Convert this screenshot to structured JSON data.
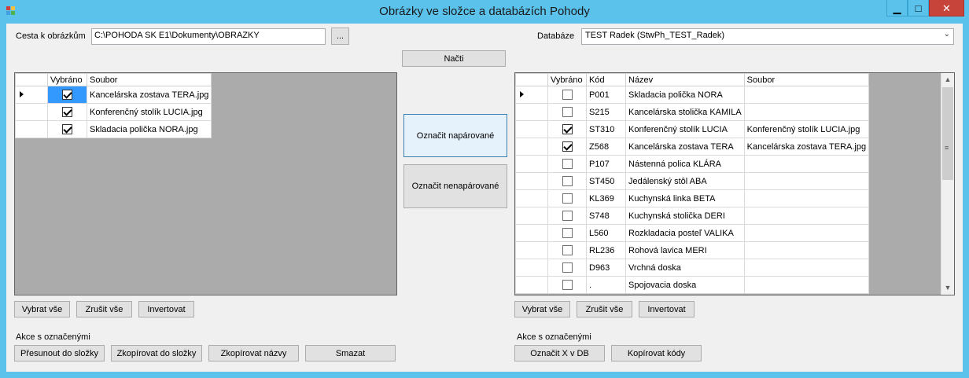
{
  "window": {
    "title": "Obrázky ve složce a databázích Pohody",
    "min_glyph": "▁",
    "max_glyph": "□",
    "close_glyph": "✕"
  },
  "top": {
    "path_label": "Cesta k obrázkům",
    "path_value": "C:\\POHODA SK E1\\Dokumenty\\OBRAZKY",
    "browse_label": "...",
    "db_label": "Databáze",
    "db_value": "TEST Radek  (StwPh_TEST_Radek)",
    "load_label": "Načti"
  },
  "left_grid": {
    "headers": [
      "Vybráno",
      "Soubor"
    ],
    "rows": [
      {
        "checked": true,
        "file": "Kancelárska zostava TERA.jpg"
      },
      {
        "checked": true,
        "file": "Konferenčný stolík LUCIA.jpg"
      },
      {
        "checked": true,
        "file": "Skladacia polička NORA.jpg"
      }
    ]
  },
  "middle": {
    "mark_paired": "Označit napárované",
    "mark_unpaired": "Označit nenapárované"
  },
  "right_grid": {
    "headers": [
      "Vybráno",
      "Kód",
      "Název",
      "Soubor"
    ],
    "rows": [
      {
        "checked": false,
        "code": "P001",
        "name": "Skladacia polička NORA",
        "file": ""
      },
      {
        "checked": false,
        "code": "S215",
        "name": "Kancelárska stolička KAMILA",
        "file": ""
      },
      {
        "checked": true,
        "code": "ST310",
        "name": "Konferenčný stolík LUCIA",
        "file": "Konferenčný stolík LUCIA.jpg"
      },
      {
        "checked": true,
        "code": "Z568",
        "name": "Kancelárska zostava TERA",
        "file": "Kancelárska zostava TERA.jpg"
      },
      {
        "checked": false,
        "code": "P107",
        "name": "Nástenná polica KLÁRA",
        "file": ""
      },
      {
        "checked": false,
        "code": "ST450",
        "name": "Jedálenský  stôl ABA",
        "file": ""
      },
      {
        "checked": false,
        "code": "KL369",
        "name": "Kuchynská linka BETA",
        "file": ""
      },
      {
        "checked": false,
        "code": "S748",
        "name": "Kuchynská stolička DERI",
        "file": ""
      },
      {
        "checked": false,
        "code": "L560",
        "name": "Rozkladacia posteľ VALIKA",
        "file": ""
      },
      {
        "checked": false,
        "code": "RL236",
        "name": "Rohová lavica MERI",
        "file": ""
      },
      {
        "checked": false,
        "code": "D963",
        "name": "Vrchná doska",
        "file": ""
      },
      {
        "checked": false,
        "code": ".",
        "name": "Spojovacia doska",
        "file": ""
      }
    ]
  },
  "left_buttons": {
    "select_all": "Vybrat vše",
    "clear_all": "Zrušit vše",
    "invert": "Invertovat"
  },
  "right_buttons": {
    "select_all": "Vybrat vše",
    "clear_all": "Zrušit vše",
    "invert": "Invertovat"
  },
  "left_actions": {
    "label": "Akce s označenými",
    "move": "Přesunout do složky",
    "copy": "Zkopírovat do složky",
    "copy_names": "Zkopírovat názvy",
    "delete": "Smazat"
  },
  "right_actions": {
    "label": "Akce s označenými",
    "mark_x": "Označit X v DB",
    "copy_codes": "Kopírovat kódy"
  }
}
